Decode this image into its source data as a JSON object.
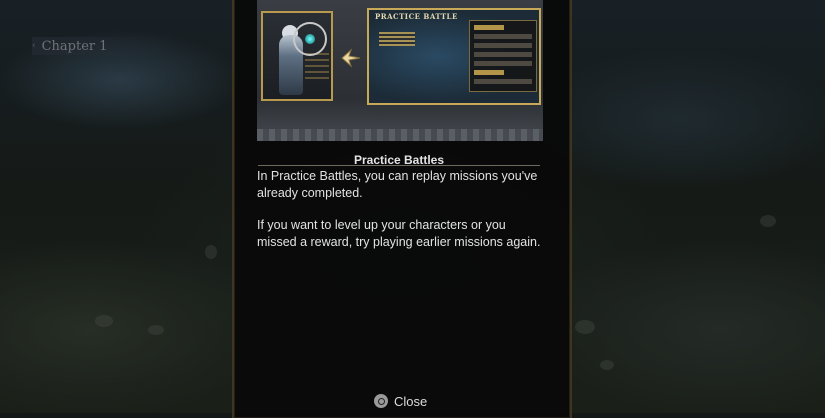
{
  "chapter_label": "Chapter 1",
  "tutorial": {
    "illustration": {
      "mini_title": "PRACTICE BATTLE"
    },
    "title": "Practice Battles",
    "paragraphs": [
      "In Practice Battles, you can replay missions you've already completed.",
      "If you want to level up your characters or you missed a reward, try playing earlier missions again."
    ]
  },
  "footer": {
    "close_label": "Close",
    "close_icon": "circle-button-icon"
  },
  "colors": {
    "gold": "#c7a957",
    "panel_bg": "#080808",
    "text": "#e2e2e2"
  }
}
